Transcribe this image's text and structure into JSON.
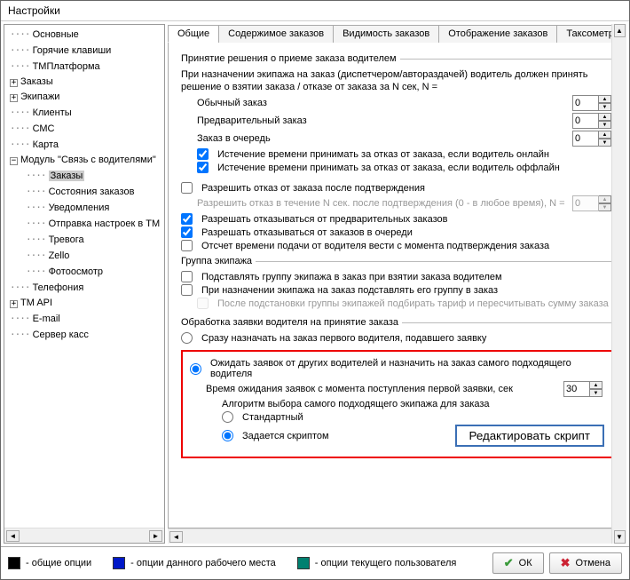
{
  "window_title": "Настройки",
  "tree": {
    "items": [
      {
        "label": "Основные",
        "depth": 0
      },
      {
        "label": "Горячие клавиши",
        "depth": 0
      },
      {
        "label": "ТМПлатформа",
        "depth": 0
      },
      {
        "label": "Заказы",
        "depth": 0,
        "expander": ">"
      },
      {
        "label": "Экипажи",
        "depth": 0,
        "expander": ">"
      },
      {
        "label": "Клиенты",
        "depth": 0
      },
      {
        "label": "СМС",
        "depth": 0
      },
      {
        "label": "Карта",
        "depth": 0
      },
      {
        "label": "Модуль \"Связь с водителями\"",
        "depth": 0,
        "expander": "v"
      },
      {
        "label": "Заказы",
        "depth": 1,
        "selected": true
      },
      {
        "label": "Состояния заказов",
        "depth": 1
      },
      {
        "label": "Уведомления",
        "depth": 1
      },
      {
        "label": "Отправка настроек в ТМ",
        "depth": 1
      },
      {
        "label": "Тревога",
        "depth": 1
      },
      {
        "label": "Zello",
        "depth": 1
      },
      {
        "label": "Фотоосмотр",
        "depth": 1
      },
      {
        "label": "Телефония",
        "depth": 0
      },
      {
        "label": "TM API",
        "depth": 0,
        "expander": ">"
      },
      {
        "label": "E-mail",
        "depth": 0
      },
      {
        "label": "Сервер касс",
        "depth": 0
      }
    ]
  },
  "tabs": [
    "Общие",
    "Содержимое заказов",
    "Видимость заказов",
    "Отображение заказов",
    "Таксометр"
  ],
  "active_tab": 0,
  "sec_accept": {
    "title": "Принятие решения о приеме заказа водителем",
    "desc": "При назначении экипажа на заказ (диспетчером/автораздачей) водитель должен принять решение о взятии заказа / отказе от заказа за N сек, N =",
    "rows": [
      {
        "label": "Обычный заказ",
        "value": "0"
      },
      {
        "label": "Предварительный заказ",
        "value": "0"
      },
      {
        "label": "Заказ в очередь",
        "value": "0"
      }
    ],
    "cb_online": {
      "checked": true,
      "label": "Истечение времени принимать за отказ от заказа, если водитель онлайн"
    },
    "cb_offline": {
      "checked": true,
      "label": "Истечение времени принимать за отказ от заказа, если водитель оффлайн"
    }
  },
  "sec_refuse": {
    "cb_allow": {
      "checked": false,
      "label": "Разрешить отказ от заказа после подтверждения"
    },
    "disabled_row": {
      "label": "Разрешить отказ в течение N сек. после подтверждения (0 - в любое время), N =",
      "value": "0"
    },
    "cb_prior": {
      "checked": true,
      "label": "Разрешать отказываться от предварительных заказов"
    },
    "cb_queue": {
      "checked": true,
      "label": "Разрешать отказываться от заказов в очереди"
    },
    "cb_timing": {
      "checked": false,
      "label": "Отсчет времени подачи от водителя вести с момента подтверждения заказа"
    }
  },
  "sec_group": {
    "title": "Группа экипажа",
    "cb_set": {
      "checked": false,
      "label": "Подставлять группу экипажа в заказ при взятии заказа водителем"
    },
    "cb_assign": {
      "checked": false,
      "label": "При назначении экипажа на заказ подставлять его группу в заказ"
    },
    "cb_recalc": {
      "checked": false,
      "label": "После подстановки группы экипажей подбирать тариф и пересчитывать сумму заказа",
      "disabled": true
    }
  },
  "sec_process": {
    "title": "Обработка заявки водителя на принятие заказа",
    "rb_immediate": {
      "checked": false,
      "label": "Сразу назначать на заказ первого водителя, подавшего заявку"
    },
    "rb_wait": {
      "checked": true,
      "label": "Ожидать заявок от других водителей и назначить на заказ самого подходящего водителя"
    },
    "wait_row": {
      "label": "Время ожидания заявок с момента поступления первой заявки, сек",
      "value": "30"
    },
    "algo_label": "Алгоритм выбора самого подходящего экипажа для заказа",
    "rb_std": {
      "checked": false,
      "label": "Стандартный"
    },
    "rb_script": {
      "checked": true,
      "label": "Задается скриптом"
    },
    "btn_edit": "Редактировать скрипт"
  },
  "legend": {
    "common": "- общие опции",
    "workplace": "- опции данного рабочего места",
    "user": "- опции текущего пользователя"
  },
  "buttons": {
    "ok": "ОК",
    "cancel": "Отмена"
  }
}
